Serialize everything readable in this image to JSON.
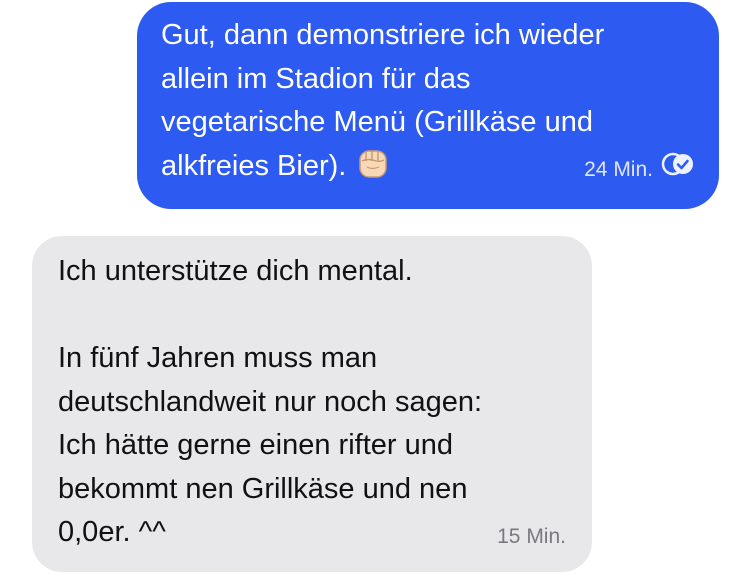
{
  "messages": {
    "outgoing": {
      "text": "Gut, dann demonstriere ich wieder\nallein im Stadion für das\nvegetarische Menü (Grillkäse und\nalkfreies Bier).",
      "emoji_icon": "raised-fist-icon",
      "time": "24 Min.",
      "status_icon": "read-receipt-icon",
      "bubble_color": "#2d5af0"
    },
    "incoming": {
      "text": "Ich unterstütze dich mental.\n\nIn fünf Jahren muss man\ndeutschlandweit nur noch sagen:\nIch hätte gerne einen rifter und\nbekommt nen Grillkäse und nen\n0,0er. ^^",
      "time": "15 Min.",
      "bubble_color": "#e8e8ea"
    }
  }
}
